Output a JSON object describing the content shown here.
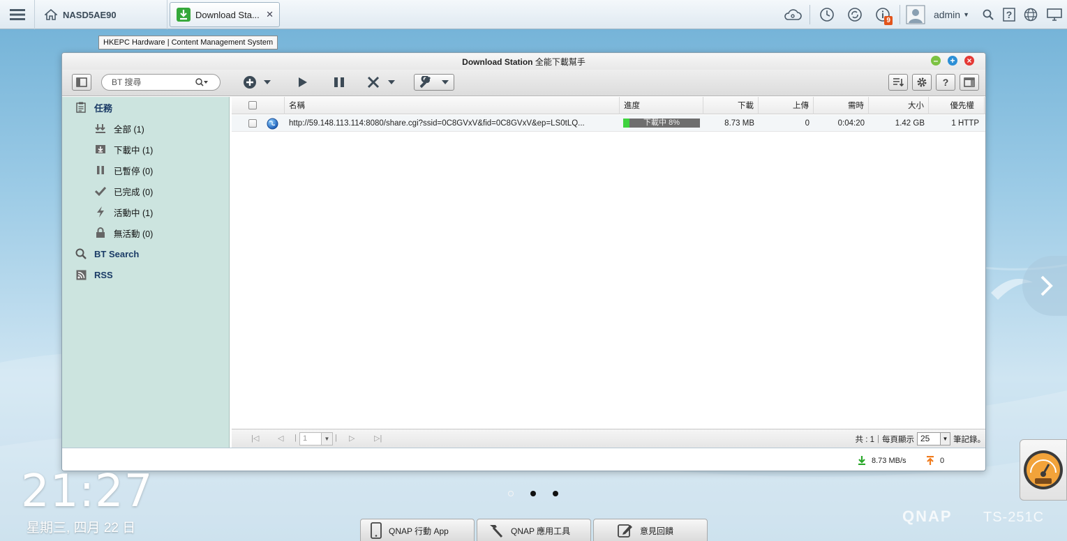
{
  "topbar": {
    "home_label": "NASD5AE90",
    "app_tab_label": "Download Sta...",
    "notification_count": "9",
    "user": "admin",
    "tooltip": "HKEPC Hardware | Content Management System"
  },
  "window": {
    "title": "Download Station",
    "title_sub": "全能下載幫手",
    "search_placeholder": "BT 搜尋"
  },
  "sidebar": {
    "tasks_label": "任務",
    "items": [
      {
        "label": "全部 (1)",
        "icon": "all-tasks-icon"
      },
      {
        "label": "下載中 (1)",
        "icon": "downloading-icon"
      },
      {
        "label": "已暫停 (0)",
        "icon": "pause-icon"
      },
      {
        "label": "已完成 (0)",
        "icon": "check-icon"
      },
      {
        "label": "活動中 (1)",
        "icon": "bolt-icon"
      },
      {
        "label": "無活動 (0)",
        "icon": "lock-icon"
      }
    ],
    "bt_search_label": "BT Search",
    "rss_label": "RSS"
  },
  "grid": {
    "columns": {
      "name": "名稱",
      "progress": "進度",
      "download": "下載",
      "upload": "上傳",
      "eta": "需時",
      "size": "大小",
      "priority": "優先權"
    },
    "rows": [
      {
        "name": "http://59.148.113.114:8080/share.cgi?ssid=0C8GVxV&fid=0C8GVxV&ep=LS0tLQ...",
        "progress_label": "下載中 8%",
        "progress_fraction": 0.08,
        "download": "8.73 MB",
        "upload": "0",
        "eta": "0:04:20",
        "size": "1.42 GB",
        "priority": "1 HTTP"
      }
    ]
  },
  "pager": {
    "page_value": "1",
    "total_label": "共 : 1",
    "per_page_label": "每頁顯示",
    "per_page_value": "25",
    "records_label": "筆記錄。"
  },
  "status": {
    "download_speed": "8.73 MB/s",
    "upload_speed": "0"
  },
  "desktop": {
    "time": "21:27",
    "date": "星期三, 四月 22 日",
    "dock_items": [
      "QNAP 行動 App",
      "QNAP 應用工具",
      "意見回饋"
    ],
    "brand": "QNAP",
    "model": "TS-251C"
  },
  "colors": {
    "sidebar_bg": "#cce4df",
    "progress_fill": "#3fd33f",
    "close_btn": "#e53935",
    "min_btn": "#7cc242",
    "max_btn": "#2c8fd6",
    "badge": "#e2541b"
  }
}
